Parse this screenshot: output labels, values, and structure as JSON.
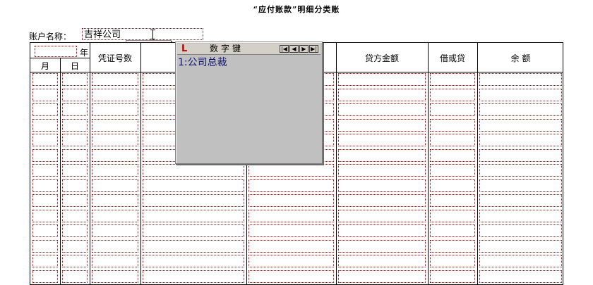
{
  "title": "“应付账款”明细分类账",
  "account": {
    "label": "账户名称：",
    "value": "吉祥公司"
  },
  "table": {
    "year_label": "年",
    "month_label": "月",
    "day_label": "日",
    "voucher_label": "凭证号数",
    "credit_label": "贷方金额",
    "dr_cr_label": "借或贷",
    "balance_label": "余  额"
  },
  "numpad": {
    "logo": "L",
    "title": "数字键",
    "nav": [
      "|◀",
      "◀",
      "▶",
      "▶|"
    ],
    "items": [
      "1:公司总裁"
    ]
  }
}
